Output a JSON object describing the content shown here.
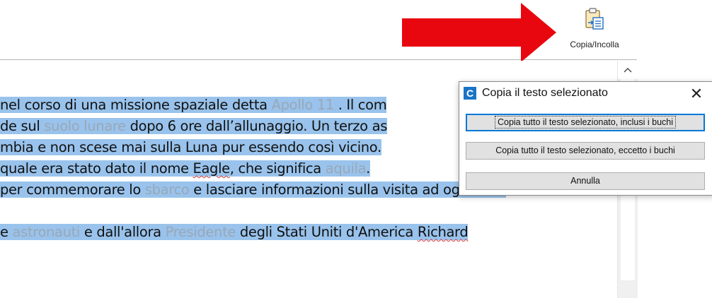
{
  "toolbar": {
    "copy_paste_label": "Copia/Incolla",
    "copy_paste_icon": "clipboard-paste-icon"
  },
  "annotation": {
    "arrow_color": "#e8070f",
    "arrow_icon": "red-arrow-pointer"
  },
  "document": {
    "selection_color": "#99c3ec",
    "hole_color": "#9aa7b7",
    "lines": [
      {
        "parts": [
          {
            "text": "nel corso di una missione spaziale detta ",
            "kind": "normal"
          },
          {
            "text": "Apollo 11",
            "kind": "hole"
          },
          {
            "text": " . Il com",
            "kind": "normal"
          }
        ]
      },
      {
        "parts": [
          {
            "text": "de sul ",
            "kind": "normal"
          },
          {
            "text": "suolo lunare",
            "kind": "hole"
          },
          {
            "text": " dopo 6 ore dall’allunaggio. Un terzo as",
            "kind": "normal"
          }
        ]
      },
      {
        "parts": [
          {
            "text": "mbia e non scese mai sulla Luna pur essendo così vicino.",
            "kind": "normal"
          }
        ]
      },
      {
        "parts": [
          {
            "text": "quale era stato dato il nome ",
            "kind": "normal"
          },
          {
            "text": "Eagle",
            "kind": "squiggle"
          },
          {
            "text": ", che significa ",
            "kind": "normal"
          },
          {
            "text": "aquila",
            "kind": "hole"
          },
          {
            "text": ".",
            "kind": "normal"
          }
        ]
      },
      {
        "parts": [
          {
            "text": "per commemorare lo ",
            "kind": "normal"
          },
          {
            "text": "sbarco",
            "kind": "hole"
          },
          {
            "text": " e lasciare informazioni sulla visita ad ogni altro",
            "kind": "normal"
          }
        ]
      },
      {
        "parts": [
          {
            "text": "e ",
            "kind": "normal"
          },
          {
            "text": "astronauti",
            "kind": "hole"
          },
          {
            "text": " e dall'allora ",
            "kind": "normal"
          },
          {
            "text": "Presidente",
            "kind": "hole"
          },
          {
            "text": " degli Stati Uniti d'America ",
            "kind": "normal"
          },
          {
            "text": "Richard",
            "kind": "squiggle"
          }
        ]
      }
    ]
  },
  "dialog": {
    "app_icon_letter": "C",
    "title": "Copia il testo selezionato",
    "close_glyph": "✕",
    "buttons": {
      "copy_with_holes": "Copia tutto il testo selezionato, inclusi i buchi",
      "copy_without_holes": "Copia tutto il testo selezionato, eccetto i buchi",
      "cancel": "Annulla"
    }
  },
  "scrollbar": {
    "up_glyph": "^"
  }
}
